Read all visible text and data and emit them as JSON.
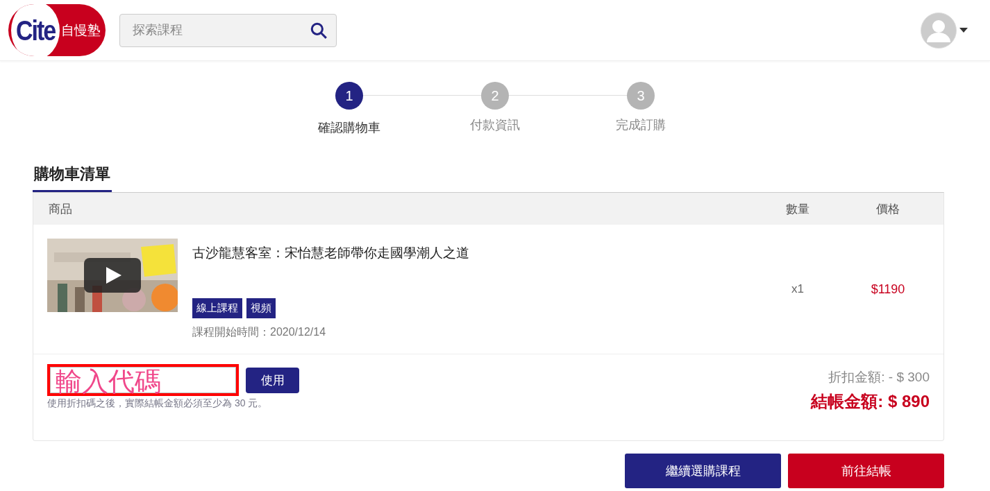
{
  "header": {
    "logo": {
      "mark": "Cite",
      "name": "自慢塾"
    },
    "search": {
      "placeholder": "探索課程"
    }
  },
  "steps": [
    {
      "number": "1",
      "label": "確認購物車",
      "selected": true
    },
    {
      "number": "2",
      "label": "付款資訊",
      "selected": false
    },
    {
      "number": "3",
      "label": "完成訂購",
      "selected": false
    }
  ],
  "cart": {
    "title": "購物車清單",
    "columns": [
      "商品",
      "數量",
      "價格"
    ],
    "items": [
      {
        "kind": "picture",
        "title": "古沙龍慧客室：宋怡慧老師帶你走國學潮人之道",
        "tags": [
          "線上課程",
          "視頻"
        ],
        "start": "課程開始時間：2020/12/14",
        "quantity": "x1",
        "price": "$1190"
      }
    ],
    "coupon": {
      "annotation": "輸入代碼",
      "button": "使用",
      "note": "使用折扣碼之後，實際結帳金額必須至少為 30 元。"
    },
    "discount": "折扣金額: - $ 300",
    "total_label": "結帳金額:",
    "total": "$ 890"
  },
  "buttons": [
    {
      "kind": "secondary",
      "label": "繼續選購課程"
    },
    {
      "kind": "primary",
      "label": "前往結帳"
    }
  ]
}
